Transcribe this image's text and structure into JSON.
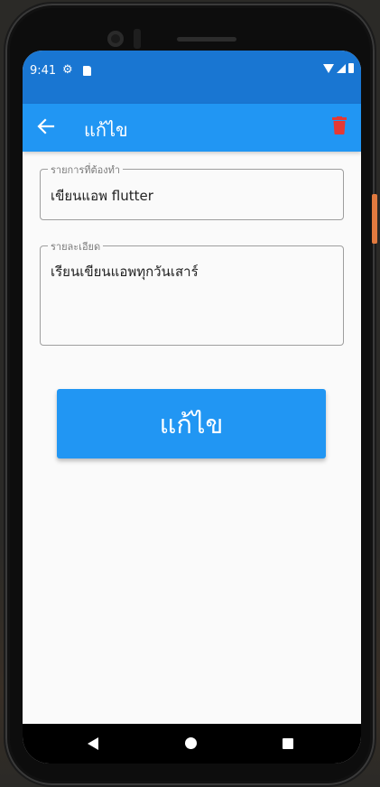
{
  "status_bar": {
    "time": "9:41",
    "icons": [
      "gear-icon",
      "sd-card-icon",
      "wifi-icon",
      "signal-icon",
      "battery-icon"
    ]
  },
  "app_bar": {
    "title": "แก้ไข",
    "back_icon": "arrow-left-icon",
    "delete_icon": "trash-icon",
    "background": "#2196f3",
    "delete_color": "#e53935"
  },
  "form": {
    "todo_field": {
      "label": "รายการที่ต้องทำ",
      "value": "เขียนแอพ flutter"
    },
    "detail_field": {
      "label": "รายละเอียด",
      "value": "เรียนเขียนแอพทุกวันเสาร์"
    },
    "submit_label": "แก้ไข"
  },
  "colors": {
    "status_bar": "#1976d2",
    "primary": "#2196f3",
    "page_background": "#fafafa"
  },
  "nav_bar": {
    "buttons": [
      "back-triangle-icon",
      "home-circle-icon",
      "recents-square-icon"
    ]
  }
}
